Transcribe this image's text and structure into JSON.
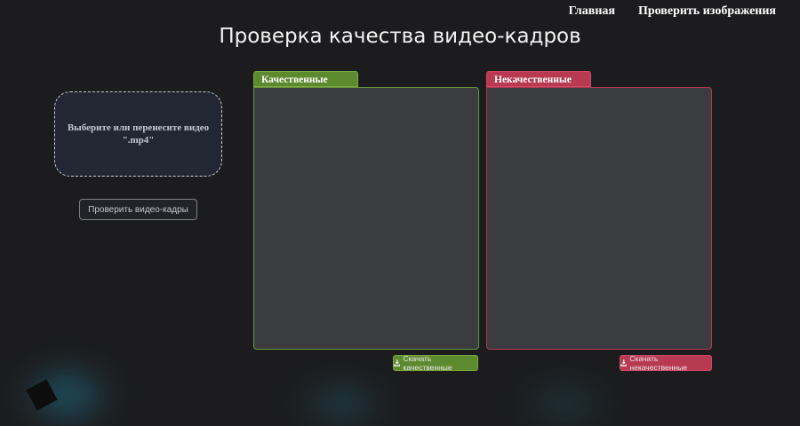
{
  "nav": {
    "home_label": "Главная",
    "check_images_label": "Проверить изображения"
  },
  "page_title": "Проверка качества видео-кадров",
  "upload": {
    "dropzone_text": "Выберите или перенесите видео \".mp4\"",
    "check_button_label": "Проверить видео-кадры"
  },
  "panels": {
    "good": {
      "tab_label": "Качественные",
      "download_label": "Скачать качественные",
      "color": "#5e8a2f"
    },
    "bad": {
      "tab_label": "Некачественные",
      "download_label": "Скачать некачественные",
      "color": "#b83952"
    }
  },
  "icons": {
    "download": "download-icon"
  }
}
